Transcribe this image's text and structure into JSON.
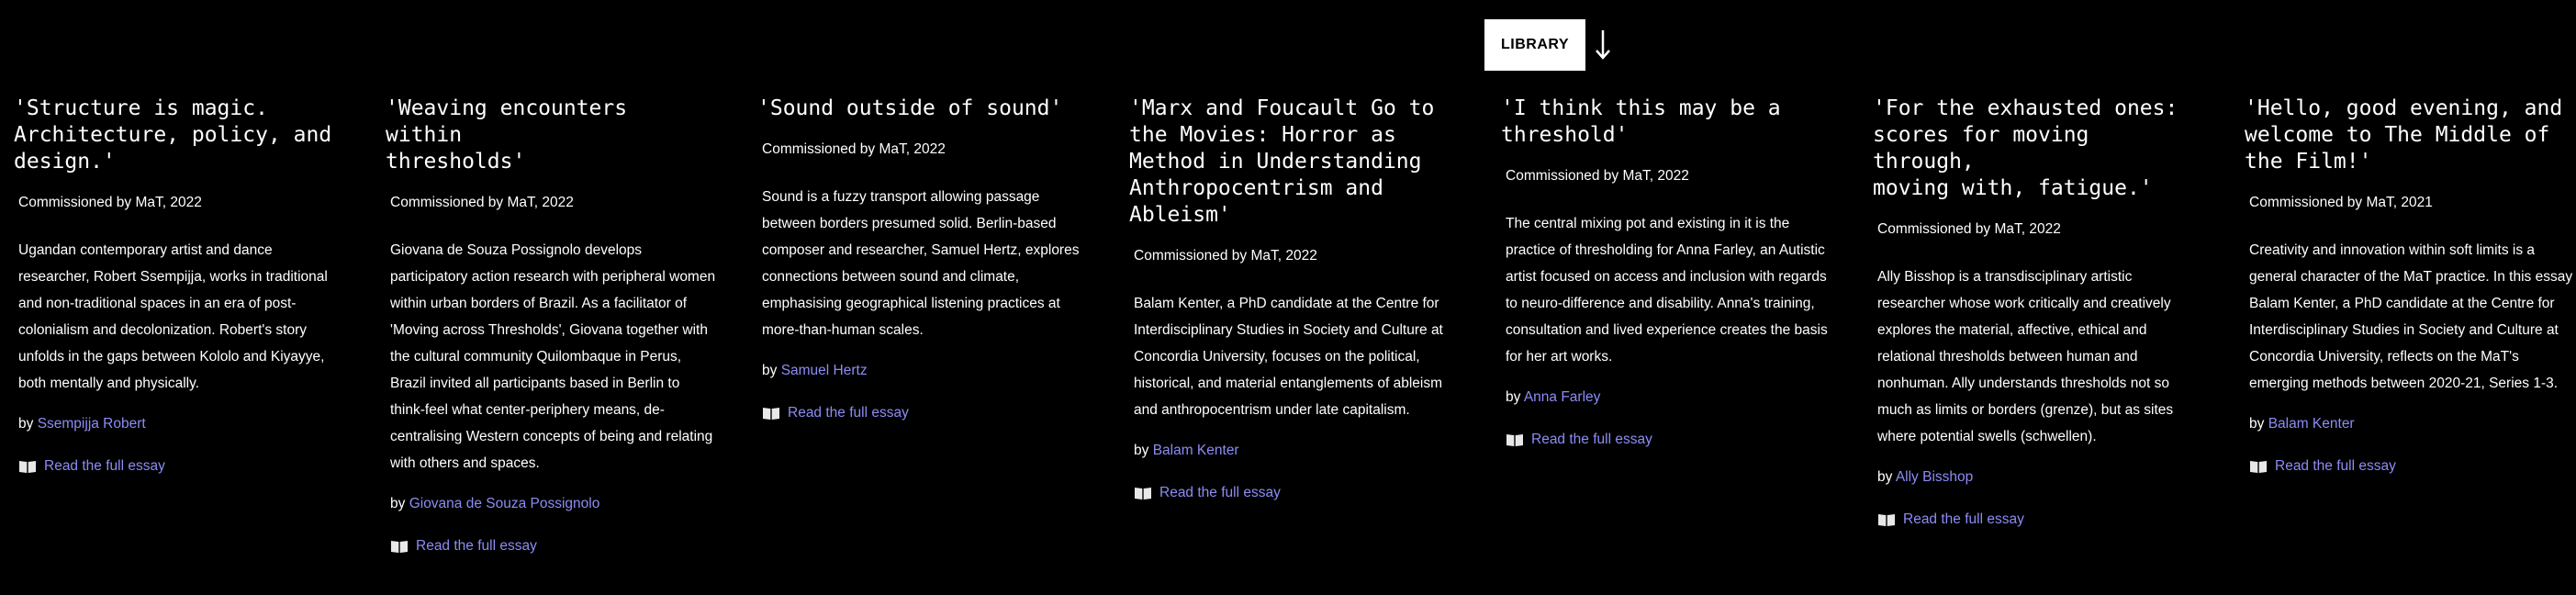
{
  "library": {
    "label": "LIBRARY",
    "icon": "arrow-down-icon"
  },
  "essays": [
    {
      "title": "'Structure is magic.\nArchitecture, policy, and\ndesign.'",
      "commission": "Commissioned by MaT, 2022",
      "description": "Ugandan contemporary artist and dance researcher, Robert Ssempijja, works in traditional and non-traditional spaces in an era of post-colonialism and decolonization. Robert's story unfolds in the gaps between Kololo and Kiyayye, both mentally and physically.",
      "by": "by",
      "author": "Ssempijja Robert",
      "read_label": "Read the full essay"
    },
    {
      "title": "'Weaving encounters within\nthresholds'",
      "commission": "Commissioned by MaT, 2022",
      "description": "Giovana de Souza Possignolo develops participatory action research with peripheral women within urban borders of Brazil. As a facilitator of 'Moving across Thresholds', Giovana together with the cultural community Quilombaque in Perus, Brazil invited all participants based in Berlin to think-feel what center-periphery means, de-centralising Western concepts of being and relating with others and spaces.",
      "by": "by",
      "author": "Giovana de Souza Possignolo",
      "read_label": "Read the full essay"
    },
    {
      "title": "'Sound outside of sound'",
      "commission": "Commissioned by MaT, 2022",
      "description": "Sound is a fuzzy transport allowing passage between borders presumed solid. Berlin-based composer and researcher, Samuel Hertz, explores connections between sound and climate, emphasising geographical listening practices at more-than-human scales.",
      "by": "by",
      "author": "Samuel Hertz",
      "read_label": "Read the full essay"
    },
    {
      "title": "'Marx and Foucault Go to\nthe Movies: Horror as\nMethod in Understanding\nAnthropocentrism and\nAbleism'",
      "commission": "Commissioned by MaT, 2022",
      "description": "Balam Kenter, a PhD candidate at the Centre for Interdisciplinary Studies in Society and Culture at Concordia University, focuses on the political, historical, and material entanglements of ableism and anthropocentrism under late capitalism.",
      "by": "by",
      "author": "Balam Kenter",
      "read_label": "Read the full essay"
    },
    {
      "title": "'I think this may be a\nthreshold'",
      "commission": "Commissioned by MaT, 2022",
      "description": "The central mixing pot and existing in it is the practice of thresholding for Anna Farley, an Autistic artist focused on access and inclusion with regards to neuro-difference and disability. Anna's training, consultation and lived experience creates the basis for her art works.",
      "by": "by",
      "author": "Anna Farley",
      "read_label": "Read the full essay"
    },
    {
      "title": "'For the exhausted ones:\nscores for moving through,\nmoving with, fatigue.'",
      "commission": "Commissioned by MaT, 2022",
      "description": "Ally Bisshop is a transdisciplinary artistic researcher whose work critically and creatively explores the material, affective, ethical and relational thresholds between human and nonhuman. Ally understands thresholds not so much as limits or borders (grenze), but as sites where potential swells (schwellen).",
      "by": "by",
      "author": "Ally Bisshop",
      "read_label": "Read the full essay"
    },
    {
      "title": "'Hello, good evening, and\nwelcome to The Middle of\nthe Film!'",
      "commission": "Commissioned by MaT, 2021",
      "description": "Creativity and innovation within soft limits is a general character of the MaT practice. In this essay Balam Kenter, a PhD candidate at the Centre for Interdisciplinary Studies in Society and Culture at Concordia University, reflects on the MaT's emerging methods between 2020-21, Series 1-3.",
      "by": "by",
      "author": "Balam Kenter",
      "read_label": "Read the full essay"
    }
  ]
}
